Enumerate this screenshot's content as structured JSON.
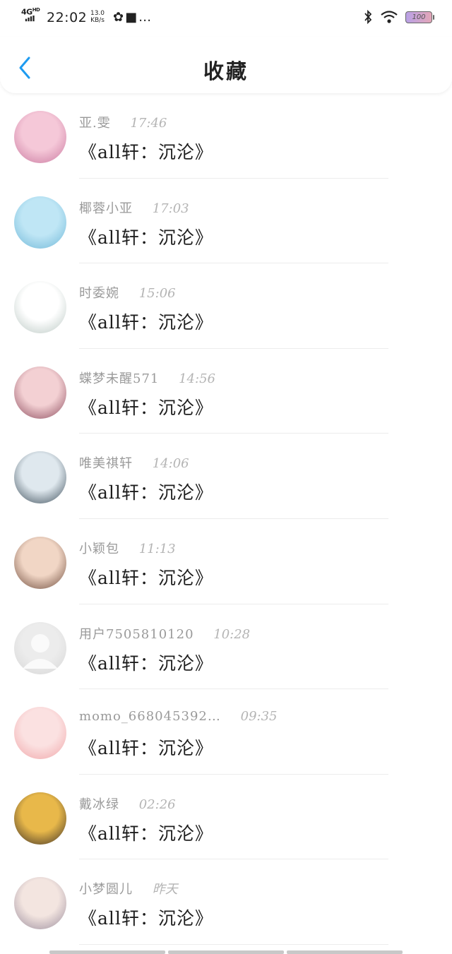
{
  "status_bar": {
    "network": "4G",
    "network_sup": "HD",
    "time": "22:02",
    "speed_value": "13.0",
    "speed_unit": "KB/s",
    "extra_icons": "✿■…",
    "battery": "100"
  },
  "header": {
    "title": "收藏"
  },
  "favorites": [
    {
      "name": "亚.雯",
      "time": "17:46",
      "title": "《all轩：沉沦》",
      "avatar_colors": [
        "#f5c8d8",
        "#c9789f"
      ]
    },
    {
      "name": "椰蓉小亚",
      "time": "17:03",
      "title": "《all轩：沉沦》",
      "avatar_colors": [
        "#bfe6f5",
        "#6fb7d8"
      ]
    },
    {
      "name": "时委婉",
      "time": "15:06",
      "title": "《all轩：沉沦》",
      "avatar_colors": [
        "#ffffff",
        "#b9c7c2"
      ]
    },
    {
      "name": "蝶梦未醒571",
      "time": "14:56",
      "title": "《all轩：沉沦》",
      "avatar_colors": [
        "#f3d0d3",
        "#8b4a5c"
      ]
    },
    {
      "name": "唯美祺轩",
      "time": "14:06",
      "title": "《all轩：沉沦》",
      "avatar_colors": [
        "#dfe8ee",
        "#3a4b57"
      ]
    },
    {
      "name": "小颖包",
      "time": "11:13",
      "title": "《all轩：沉沦》",
      "avatar_colors": [
        "#f1d6c5",
        "#6d4a3b"
      ]
    },
    {
      "name": "用户7505810120",
      "time": "10:28",
      "title": "《all轩：沉沦》",
      "avatar_colors": [
        "#ececec",
        "#d6d6d6"
      ]
    },
    {
      "name": "momo_668045392…",
      "time": "09:35",
      "title": "《all轩：沉沦》",
      "avatar_colors": [
        "#fbe1e1",
        "#f0a5a8"
      ]
    },
    {
      "name": "戴冰绿",
      "time": "02:26",
      "title": "《all轩：沉沦》",
      "avatar_colors": [
        "#e8b84a",
        "#3b2e25"
      ]
    },
    {
      "name": "小梦圆儿",
      "time": "昨天",
      "title": "《all轩：沉沦》",
      "avatar_colors": [
        "#f3e5e0",
        "#9a8c9c"
      ]
    }
  ]
}
